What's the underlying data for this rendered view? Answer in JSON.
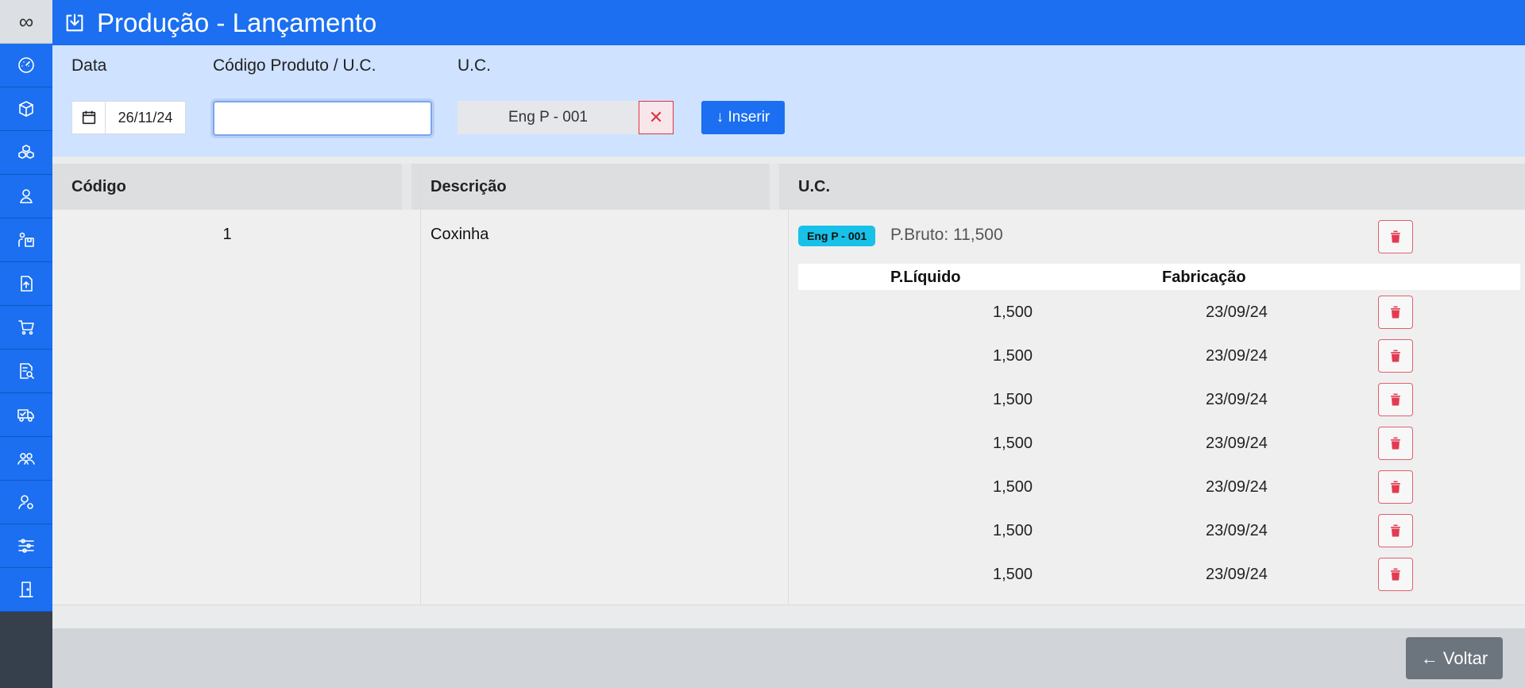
{
  "app": {
    "logo_symbol": "∞",
    "title": "Produção - Lançamento",
    "title_icon": "download-box-icon"
  },
  "sidebar": {
    "items": [
      {
        "icon": "dashboard-icon"
      },
      {
        "icon": "box-icon"
      },
      {
        "icon": "boxes-icon"
      },
      {
        "icon": "user-icon"
      },
      {
        "icon": "warehouse-user-icon"
      },
      {
        "icon": "upload-file-icon"
      },
      {
        "icon": "cart-icon"
      },
      {
        "icon": "report-search-icon"
      },
      {
        "icon": "truck-check-icon"
      },
      {
        "icon": "users-icon"
      },
      {
        "icon": "user-settings-icon"
      },
      {
        "icon": "sliders-icon"
      },
      {
        "icon": "exit-door-icon"
      }
    ]
  },
  "form": {
    "date_label": "Data",
    "date_value": "26/11/24",
    "code_label": "Código Produto / U.C.",
    "code_value": "",
    "uc_label": "U.C.",
    "uc_value": "Eng P - 001",
    "uc_clear_symbol": "✕",
    "insert_label": "↓ Inserir"
  },
  "table": {
    "headers": {
      "code": "Código",
      "description": "Descrição",
      "uc": "U.C."
    },
    "row": {
      "code": "1",
      "description": "Coxinha",
      "uc_badge": "Eng P - 001",
      "peso_bruto": "P.Bruto: 11,500",
      "sub_headers": {
        "peso_liquido": "P.Líquido",
        "fabricacao": "Fabricação"
      },
      "items": [
        {
          "peso_liquido": "1,500",
          "fabricacao": "23/09/24"
        },
        {
          "peso_liquido": "1,500",
          "fabricacao": "23/09/24"
        },
        {
          "peso_liquido": "1,500",
          "fabricacao": "23/09/24"
        },
        {
          "peso_liquido": "1,500",
          "fabricacao": "23/09/24"
        },
        {
          "peso_liquido": "1,500",
          "fabricacao": "23/09/24"
        },
        {
          "peso_liquido": "1,500",
          "fabricacao": "23/09/24"
        },
        {
          "peso_liquido": "1,500",
          "fabricacao": "23/09/24"
        }
      ]
    }
  },
  "footer": {
    "back_label": "← Voltar"
  },
  "colors": {
    "primary": "#1b6ff0",
    "form_bg": "#cfe2ff",
    "danger": "#dc3545",
    "badge": "#17c1e8",
    "secondary": "#6c757d"
  }
}
